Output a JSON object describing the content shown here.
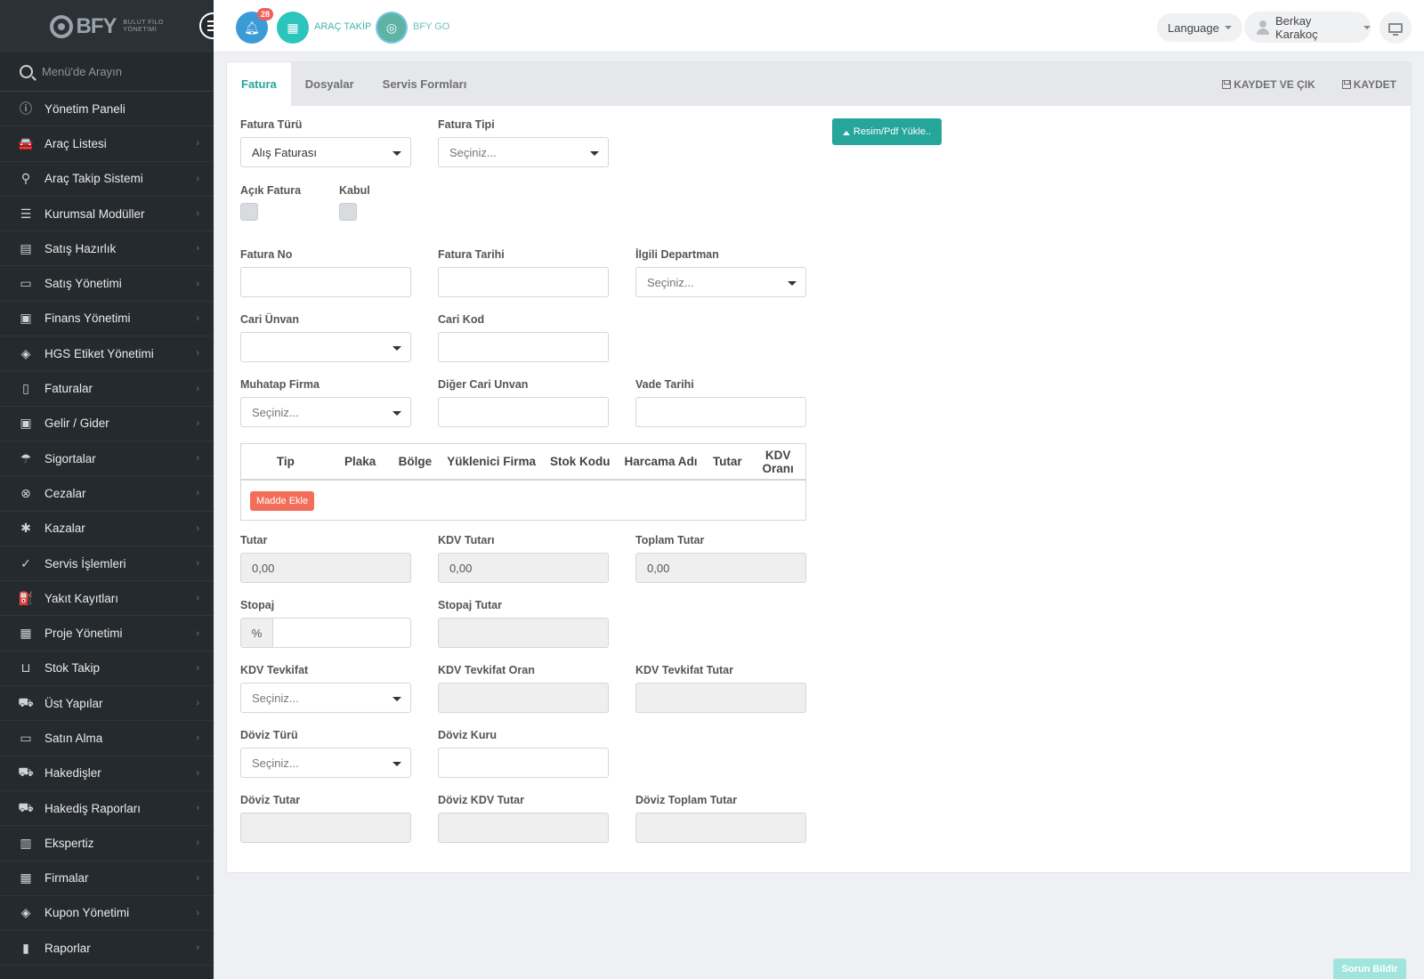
{
  "sidebar": {
    "logo_text": "BFY",
    "logo_sub": "BULUT FİLO YÖNETİMİ",
    "search_placeholder": "Menü'de Arayın",
    "items": [
      {
        "label": "Yönetim Paneli",
        "icon": "info-icon",
        "glyph": "ⓘ",
        "chevron": false
      },
      {
        "label": "Araç Listesi",
        "icon": "car-icon",
        "glyph": "🚘",
        "chevron": true
      },
      {
        "label": "Araç Takip Sistemi",
        "icon": "map-marker-icon",
        "glyph": "⚲",
        "chevron": true
      },
      {
        "label": "Kurumsal Modüller",
        "icon": "server-icon",
        "glyph": "☰",
        "chevron": true
      },
      {
        "label": "Satış Hazırlık",
        "icon": "book-icon",
        "glyph": "▤",
        "chevron": true
      },
      {
        "label": "Satış Yönetimi",
        "icon": "credit-card-icon",
        "glyph": "▭",
        "chevron": true
      },
      {
        "label": "Finans Yönetimi",
        "icon": "money-icon",
        "glyph": "▣",
        "chevron": true
      },
      {
        "label": "HGS Etiket Yönetimi",
        "icon": "tag-icon",
        "glyph": "◈",
        "chevron": true
      },
      {
        "label": "Faturalar",
        "icon": "file-icon",
        "glyph": "▯",
        "chevron": true
      },
      {
        "label": "Gelir / Gider",
        "icon": "cash-icon",
        "glyph": "▣",
        "chevron": true
      },
      {
        "label": "Sigortalar",
        "icon": "umbrella-icon",
        "glyph": "☂",
        "chevron": true
      },
      {
        "label": "Cezalar",
        "icon": "times-circle-icon",
        "glyph": "⊗",
        "chevron": true
      },
      {
        "label": "Kazalar",
        "icon": "car-crash-icon",
        "glyph": "✱",
        "chevron": true
      },
      {
        "label": "Servis İşlemleri",
        "icon": "check-circle-icon",
        "glyph": "✓",
        "chevron": true
      },
      {
        "label": "Yakıt Kayıtları",
        "icon": "gas-pump-icon",
        "glyph": "⛽",
        "chevron": true
      },
      {
        "label": "Proje Yönetimi",
        "icon": "briefcase-icon",
        "glyph": "▦",
        "chevron": true
      },
      {
        "label": "Stok Takip",
        "icon": "inbox-icon",
        "glyph": "⊔",
        "chevron": true
      },
      {
        "label": "Üst Yapılar",
        "icon": "truck-icon",
        "glyph": "⛟",
        "chevron": true
      },
      {
        "label": "Satın Alma",
        "icon": "credit-card-icon",
        "glyph": "▭",
        "chevron": true
      },
      {
        "label": "Hakedişler",
        "icon": "truck-icon",
        "glyph": "⛟",
        "chevron": true
      },
      {
        "label": "Hakediş Raporları",
        "icon": "truck-icon",
        "glyph": "⛟",
        "chevron": true
      },
      {
        "label": "Ekspertiz",
        "icon": "clipboard-icon",
        "glyph": "▥",
        "chevron": true
      },
      {
        "label": "Firmalar",
        "icon": "building-icon",
        "glyph": "▦",
        "chevron": true
      },
      {
        "label": "Kupon Yönetimi",
        "icon": "ticket-icon",
        "glyph": "◈",
        "chevron": true
      },
      {
        "label": "Raporlar",
        "icon": "bar-chart-icon",
        "glyph": "▮",
        "chevron": true
      }
    ]
  },
  "topbar": {
    "notifications_count": "28",
    "arac_takip": "ARAÇ TAKİP",
    "bfy_go": "BFY GO",
    "language": "Language",
    "user_name": "Berkay Karakoç"
  },
  "tabs": [
    "Fatura",
    "Dosyalar",
    "Servis Formları"
  ],
  "actions": {
    "save_exit": "KAYDET VE ÇIK",
    "save": "KAYDET"
  },
  "upload_label": "Resim/Pdf Yükle..",
  "form": {
    "fatura_turu": {
      "label": "Fatura Türü",
      "value": "Alış Faturası"
    },
    "fatura_tipi": {
      "label": "Fatura Tipi",
      "placeholder": "Seçiniz..."
    },
    "acik_fatura": {
      "label": "Açık Fatura"
    },
    "kabul": {
      "label": "Kabul"
    },
    "fatura_no": {
      "label": "Fatura No",
      "value": ""
    },
    "fatura_tarihi": {
      "label": "Fatura Tarihi",
      "value": ""
    },
    "ilgili_departman": {
      "label": "İlgili Departman",
      "placeholder": "Seçiniz..."
    },
    "cari_unvan": {
      "label": "Cari Ünvan",
      "value": ""
    },
    "cari_kod": {
      "label": "Cari Kod",
      "value": ""
    },
    "muhatap_firma": {
      "label": "Muhatap Firma",
      "placeholder": "Seçiniz..."
    },
    "diger_cari_unvan": {
      "label": "Diğer Cari Unvan",
      "value": ""
    },
    "vade_tarihi": {
      "label": "Vade Tarihi",
      "value": ""
    },
    "tutar": {
      "label": "Tutar",
      "value": "0,00"
    },
    "kdv_tutari": {
      "label": "KDV Tutarı",
      "value": "0,00"
    },
    "toplam_tutar": {
      "label": "Toplam Tutar",
      "value": "0,00"
    },
    "stopaj": {
      "label": "Stopaj",
      "prefix": "%",
      "value": ""
    },
    "stopaj_tutar": {
      "label": "Stopaj Tutar",
      "value": ""
    },
    "kdv_tevkifat": {
      "label": "KDV Tevkifat",
      "placeholder": "Seçiniz..."
    },
    "kdv_tevkifat_oran": {
      "label": "KDV Tevkifat Oran",
      "value": ""
    },
    "kdv_tevkifat_tutar": {
      "label": "KDV Tevkifat Tutar",
      "value": ""
    },
    "doviz_turu": {
      "label": "Döviz Türü",
      "placeholder": "Seçiniz..."
    },
    "doviz_kuru": {
      "label": "Döviz Kuru",
      "value": ""
    },
    "doviz_tutar": {
      "label": "Döviz Tutar",
      "value": ""
    },
    "doviz_kdv_tutar": {
      "label": "Döviz KDV Tutar",
      "value": ""
    },
    "doviz_toplam_tutar": {
      "label": "Döviz Toplam Tutar",
      "value": ""
    }
  },
  "items_table": {
    "columns": [
      "Tip",
      "Plaka",
      "Bölge",
      "Yüklenici Firma",
      "Stok Kodu",
      "Harcama Adı",
      "Tutar",
      "KDV Oranı"
    ],
    "add_label": "Madde Ekle"
  },
  "report_button": "Sorun Bildir",
  "colors": {
    "accent": "#26a69a",
    "sidebar": "#252a2e",
    "danger": "#f36e5a"
  }
}
